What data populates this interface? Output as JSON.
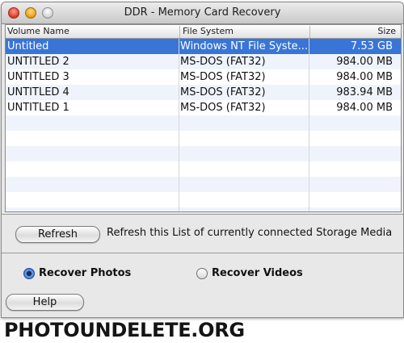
{
  "window": {
    "title": "DDR - Memory Card Recovery"
  },
  "table": {
    "headers": {
      "volume": "Volume Name",
      "file_system": "File System",
      "size": "Size"
    },
    "rows": [
      {
        "volume": "Untitled",
        "file_system": "Windows NT File Syste...",
        "size": "7.53  GB",
        "selected": true
      },
      {
        "volume": "UNTITLED 2",
        "file_system": "MS-DOS (FAT32)",
        "size": "984.00  MB"
      },
      {
        "volume": "UNTITLED 3",
        "file_system": "MS-DOS (FAT32)",
        "size": "984.00  MB"
      },
      {
        "volume": "UNTITLED 4",
        "file_system": "MS-DOS (FAT32)",
        "size": "983.94  MB"
      },
      {
        "volume": "UNTITLED 1",
        "file_system": "MS-DOS (FAT32)",
        "size": "984.00  MB"
      }
    ]
  },
  "refresh": {
    "button_label": "Refresh",
    "description": "Refresh this List of currently connected Storage Media"
  },
  "mode": {
    "photos_label": "Recover Photos",
    "videos_label": "Recover Videos",
    "selected": "photos"
  },
  "help": {
    "button_label": "Help"
  },
  "watermark": "PHOTOUNDELETE.ORG",
  "colors": {
    "selection": "#3875d7",
    "alt_row": "#eff4fc"
  }
}
